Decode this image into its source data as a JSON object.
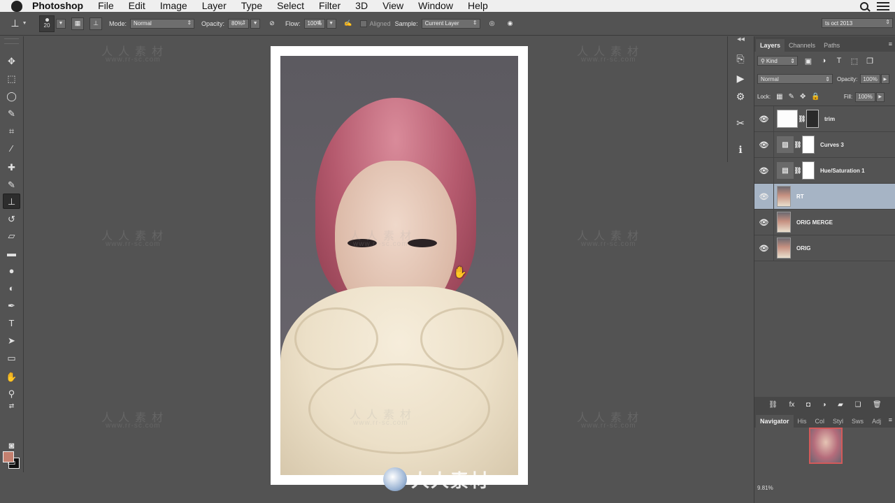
{
  "menubar": {
    "app": "Photoshop",
    "items": [
      "File",
      "Edit",
      "Image",
      "Layer",
      "Type",
      "Select",
      "Filter",
      "3D",
      "View",
      "Window",
      "Help"
    ]
  },
  "options": {
    "brush_size": "20",
    "mode_label": "Mode:",
    "mode_value": "Normal",
    "opacity_label": "Opacity:",
    "opacity_value": "80%",
    "flow_label": "Flow:",
    "flow_value": "100%",
    "aligned_label": "Aligned",
    "sample_label": "Sample:",
    "sample_value": "Current Layer",
    "workspace_value": "ts oct 2013"
  },
  "toolbar": {
    "tools": [
      {
        "name": "move-tool",
        "glyph": "✥"
      },
      {
        "name": "marquee-tool",
        "glyph": "⬚"
      },
      {
        "name": "lasso-tool",
        "glyph": "◯"
      },
      {
        "name": "quick-select-tool",
        "glyph": "✎"
      },
      {
        "name": "crop-tool",
        "glyph": "⌗"
      },
      {
        "name": "eyedropper-tool",
        "glyph": "⁄"
      },
      {
        "name": "healing-brush-tool",
        "glyph": "✚"
      },
      {
        "name": "brush-tool",
        "glyph": "✎"
      },
      {
        "name": "clone-stamp-tool",
        "glyph": "⊥"
      },
      {
        "name": "history-brush-tool",
        "glyph": "↺"
      },
      {
        "name": "eraser-tool",
        "glyph": "▱"
      },
      {
        "name": "gradient-tool",
        "glyph": "▬"
      },
      {
        "name": "blur-tool",
        "glyph": "●"
      },
      {
        "name": "dodge-tool",
        "glyph": "◐"
      },
      {
        "name": "pen-tool",
        "glyph": "✒"
      },
      {
        "name": "type-tool",
        "glyph": "T"
      },
      {
        "name": "path-select-tool",
        "glyph": "➤"
      },
      {
        "name": "rectangle-tool",
        "glyph": "▭"
      },
      {
        "name": "hand-tool",
        "glyph": "✋"
      },
      {
        "name": "zoom-tool",
        "glyph": "⚲"
      }
    ],
    "foreground_color": "#c4806f",
    "background_color": "#111111"
  },
  "layers_panel": {
    "tabs": [
      "Layers",
      "Channels",
      "Paths"
    ],
    "kind_label": "Kind",
    "blend_mode": "Normal",
    "opacity_label": "Opacity:",
    "opacity_value": "100%",
    "lock_label": "Lock:",
    "fill_label": "Fill:",
    "fill_value": "100%",
    "layers": [
      {
        "name": "trim",
        "type": "image-with-mask",
        "selected": false
      },
      {
        "name": "Curves 3",
        "type": "curves-adjustment",
        "selected": false
      },
      {
        "name": "Hue/Saturation 1",
        "type": "hue-saturation-adjustment",
        "selected": false
      },
      {
        "name": "RT",
        "type": "image",
        "selected": true
      },
      {
        "name": "ORIG MERGE",
        "type": "image",
        "selected": false
      },
      {
        "name": "ORIG",
        "type": "image",
        "selected": false
      }
    ]
  },
  "navigator_panel": {
    "tabs": [
      "Navigator",
      "His",
      "Col",
      "Styl",
      "Sws",
      "Adj"
    ],
    "zoom": "9.81%"
  },
  "watermarks": {
    "cn_text": "人人素材",
    "url": "www.rr-sc.com",
    "bottom_text": "人人素材"
  }
}
